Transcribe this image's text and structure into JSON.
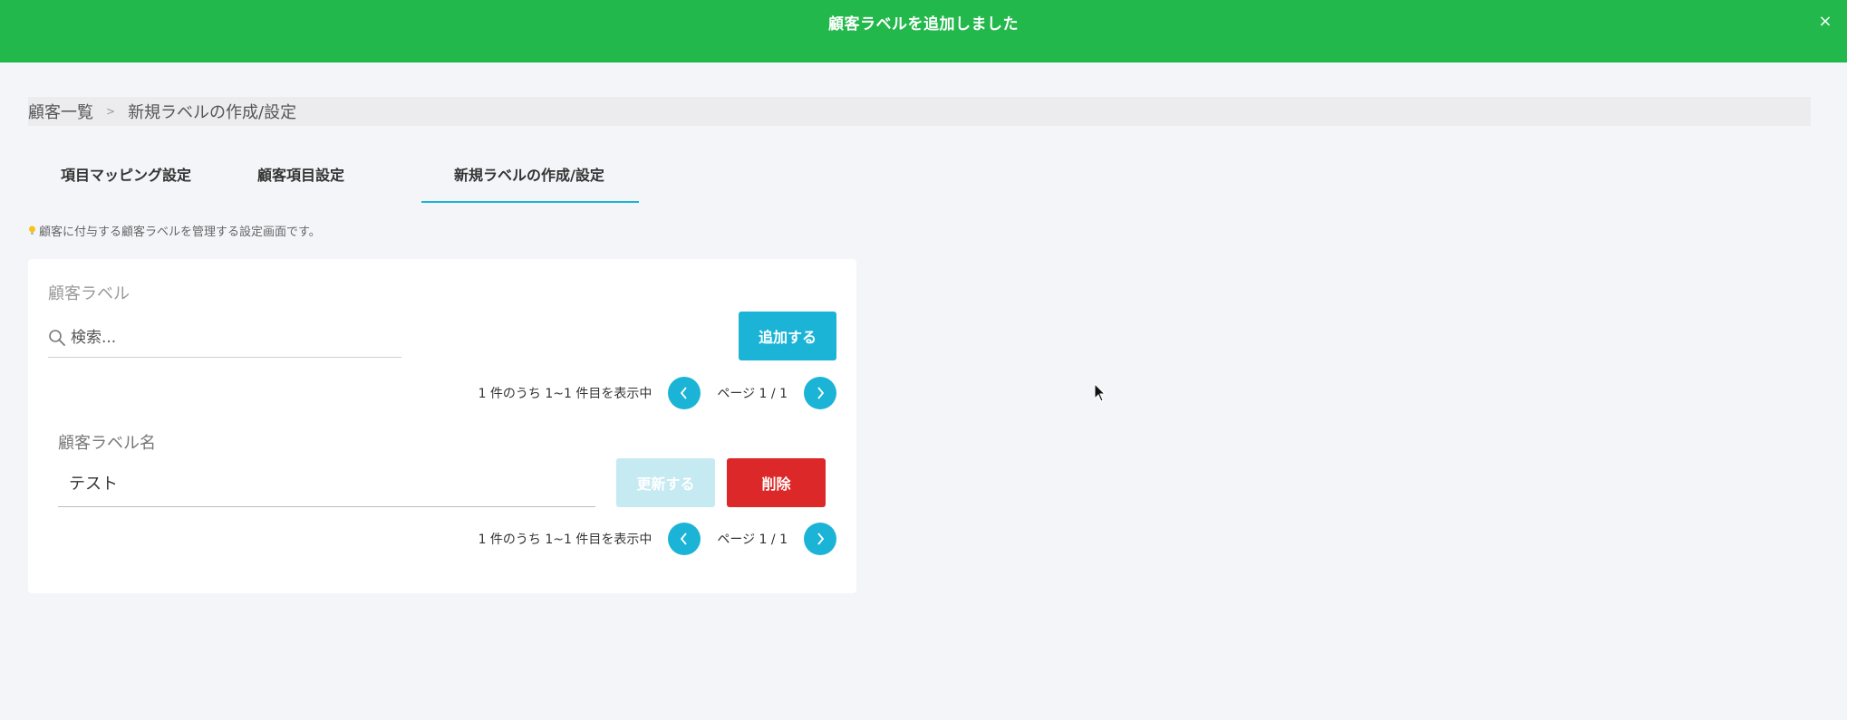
{
  "toast": {
    "message": "顧客ラベルを追加しました",
    "close_label": "×",
    "background": "#22b84b"
  },
  "breadcrumb": {
    "items": [
      "顧客一覧",
      "新規ラベルの作成/設定"
    ],
    "separator": ">"
  },
  "tabs": [
    {
      "label": "項目マッピング設定",
      "active": false
    },
    {
      "label": "顧客項目設定",
      "active": false
    },
    {
      "label": "新規ラベルの作成/設定",
      "active": true
    }
  ],
  "hint": {
    "icon": "lightbulb-icon",
    "text": "顧客に付与する顧客ラベルを管理する設定画面です。"
  },
  "card": {
    "title": "顧客ラベル",
    "search": {
      "placeholder": "検索...",
      "value": ""
    },
    "add_button": "追加する",
    "pager_top": {
      "summary": "1 件のうち 1~1 件目を表示中",
      "page": "ページ 1 / 1"
    },
    "label_name_caption": "顧客ラベル名",
    "label_name_value": "テスト",
    "update_button": "更新する",
    "delete_button": "削除",
    "pager_bottom": {
      "summary": "1 件のうち 1~1 件目を表示中",
      "page": "ページ 1 / 1"
    }
  },
  "colors": {
    "accent": "#1bb4d6",
    "danger": "#dc2828",
    "disabled": "#c6eaf2",
    "success": "#22b84b"
  }
}
